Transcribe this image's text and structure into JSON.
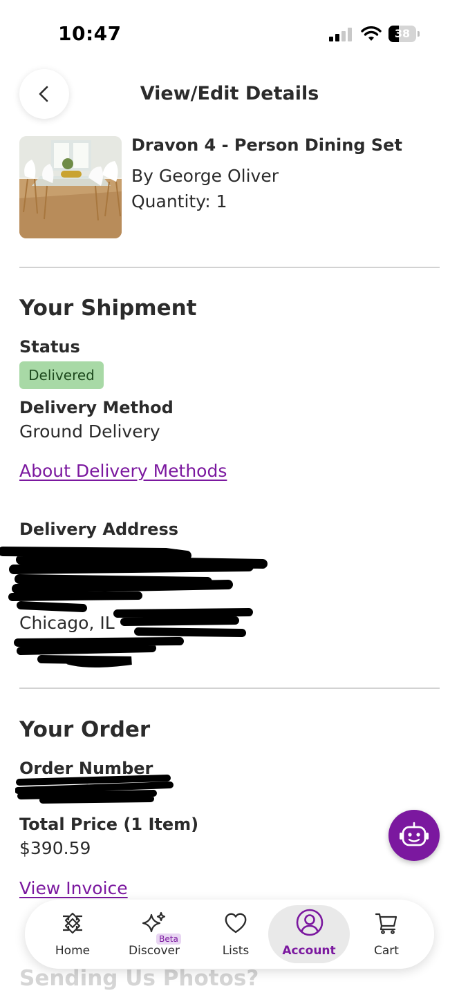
{
  "status_bar": {
    "time": "10:47",
    "battery": "38",
    "battery_level": 0.38
  },
  "header": {
    "title": "View/Edit Details"
  },
  "product": {
    "name": "Dravon 4 - Person Dining Set",
    "brand": "By George Oliver",
    "quantity": "Quantity: 1"
  },
  "shipment": {
    "heading": "Your Shipment",
    "status_label": "Status",
    "status_value": "Delivered",
    "method_label": "Delivery Method",
    "method_value": "Ground Delivery",
    "about_link": "About Delivery Methods",
    "address_label": "Delivery Address",
    "address_city": "Chicago, IL"
  },
  "order": {
    "heading": "Your Order",
    "number_label": "Order Number",
    "total_label": "Total Price (1 Item)",
    "total_value": "$390.59",
    "invoice_link": "View Invoice"
  },
  "next_section": {
    "heading": "Sending Us Photos?"
  },
  "bottom_nav": {
    "items": [
      {
        "label": "Home",
        "icon": "home-icon"
      },
      {
        "label": "Discover",
        "icon": "sparkle-icon",
        "badge": "Beta"
      },
      {
        "label": "Lists",
        "icon": "heart-icon"
      },
      {
        "label": "Account",
        "icon": "account-icon",
        "active": true
      },
      {
        "label": "Cart",
        "icon": "cart-icon"
      }
    ]
  },
  "colors": {
    "accent": "#7b189f",
    "status_badge": "#a8d9a6",
    "text": "#2b2b2b"
  }
}
